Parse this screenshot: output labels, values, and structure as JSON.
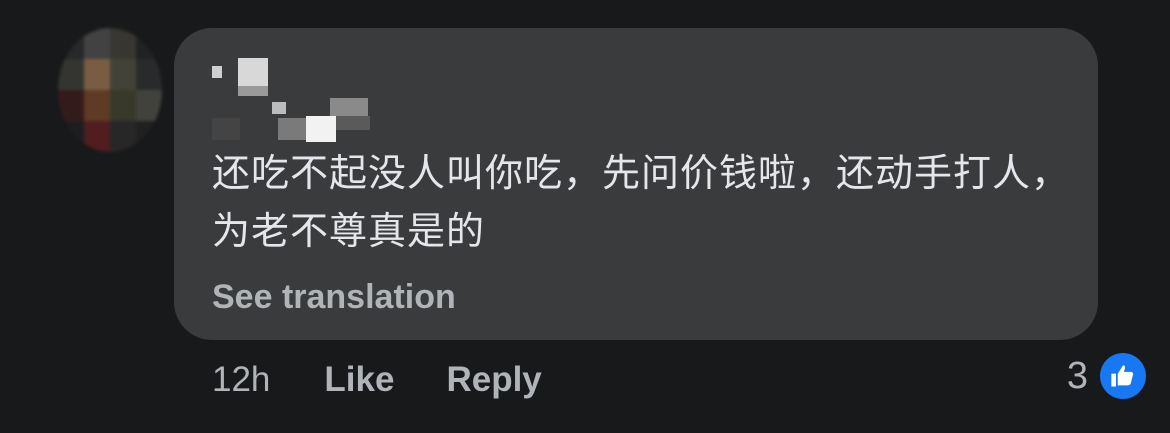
{
  "comment": {
    "author_name": "",
    "text": "还吃不起没人叫你吃，先问价钱啦，还动手打人，为老不尊真是的",
    "see_translation_label": "See translation"
  },
  "actions": {
    "timestamp": "12h",
    "like_label": "Like",
    "reply_label": "Reply"
  },
  "reactions": {
    "count": "3",
    "icon": "thumbs-up-icon",
    "badge_color": "#1877f2"
  },
  "colors": {
    "background": "#18191a",
    "bubble": "#3a3b3c",
    "primary_text": "#e4e6eb",
    "secondary_text": "#b0b3b8"
  }
}
